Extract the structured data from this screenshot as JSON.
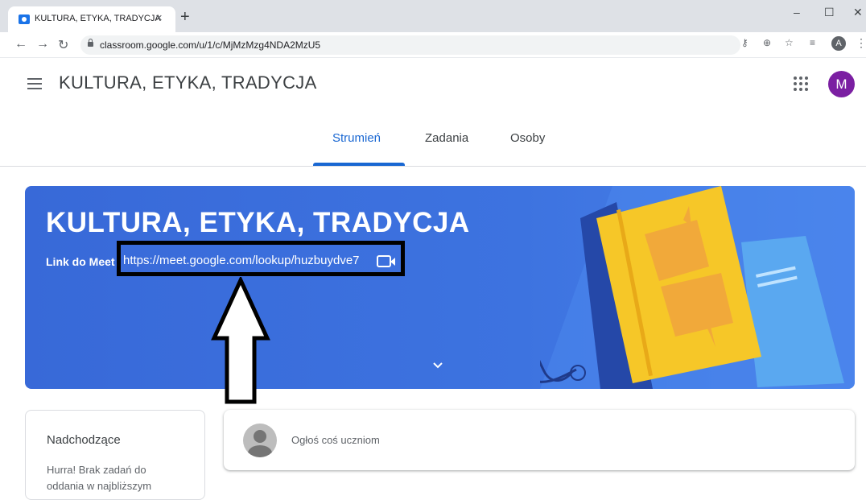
{
  "browser": {
    "tab_title": "KULTURA, ETYKA, TRADYCJA",
    "tab_close": "×",
    "new_tab": "+",
    "url": "classroom.google.com/u/1/c/MjMzMzg4NDA2MzU5",
    "profile_initial": "A",
    "window_min": "–",
    "window_max": "☐",
    "window_close": "✕"
  },
  "header": {
    "class_title": "KULTURA, ETYKA, TRADYCJA",
    "avatar_initial": "M",
    "avatar_color": "#7b1fa2"
  },
  "tabs": [
    {
      "label": "Strumień",
      "active": true
    },
    {
      "label": "Zadania",
      "active": false
    },
    {
      "label": "Osoby",
      "active": false
    }
  ],
  "banner": {
    "title": "KULTURA, ETYKA, TRADYCJA",
    "meet_label": "Link do Meet",
    "meet_link": "https://meet.google.com/lookup/huzbuydve7",
    "color": "#3d73e0"
  },
  "upcoming": {
    "title": "Nadchodzące",
    "text": "Hurra! Brak zadań do oddania w najbliższym"
  },
  "announce": {
    "placeholder": "Ogłoś coś uczniom"
  },
  "colors": {
    "accent": "#1967d2",
    "highlight_border": "#000000"
  }
}
